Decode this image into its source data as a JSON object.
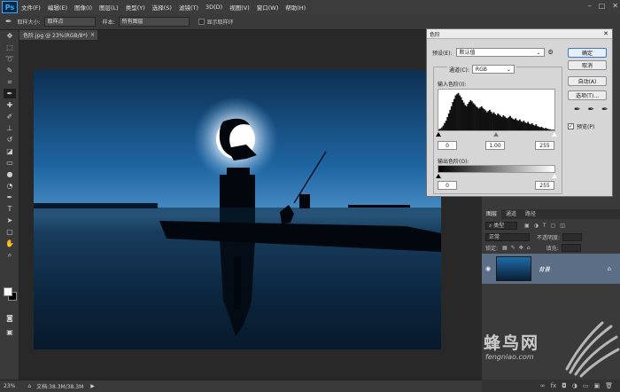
{
  "app": {
    "logo": "Ps"
  },
  "menubar": {
    "items": [
      "文件(F)",
      "编辑(E)",
      "图像(I)",
      "图层(L)",
      "类型(Y)",
      "选择(S)",
      "滤镜(T)",
      "3D(D)",
      "视图(V)",
      "窗口(W)",
      "帮助(H)"
    ],
    "window_controls": [
      "–",
      "□",
      "✕"
    ]
  },
  "optionsbar": {
    "sample_size_label": "取样大小:",
    "sample_size_value": "取样点",
    "sample_label": "样本:",
    "sample_value": "所有图层",
    "show_ring_label": "显示取样环"
  },
  "document": {
    "tab_title": "色阶.jpg @ 23%(RGB/8*)",
    "close": "×"
  },
  "statusbar": {
    "zoom": "23%",
    "doc_info": "文档:38.3M/38.3M"
  },
  "levels": {
    "title": "色阶",
    "close": "✕",
    "preset_label": "预设(E):",
    "preset_value": "默认值",
    "channel_label": "通道(C):",
    "channel_value": "RGB",
    "input_label": "输入色阶(I):",
    "input_black": "0",
    "input_gamma": "1.00",
    "input_white": "255",
    "output_label": "输出色阶(O):",
    "output_black": "0",
    "output_white": "255",
    "buttons": {
      "ok": "确定",
      "cancel": "取消",
      "auto": "自动(A)",
      "options": "选项(T)..."
    },
    "preview_label": "预览(P)",
    "preview_checked": true,
    "histogram": [
      2,
      3,
      5,
      8,
      12,
      16,
      22,
      28,
      34,
      40,
      47,
      52,
      58,
      60,
      62,
      58,
      55,
      50,
      46,
      42,
      40,
      44,
      47,
      50,
      48,
      45,
      43,
      40,
      38,
      36,
      38,
      40,
      37,
      35,
      33,
      30,
      32,
      34,
      31,
      28,
      30,
      27,
      25,
      28,
      26,
      24,
      22,
      25,
      23,
      21,
      20,
      22,
      24,
      21,
      19,
      18,
      20,
      17,
      16,
      18,
      15,
      14,
      16,
      13,
      12,
      14,
      11,
      10,
      12,
      9,
      8,
      10,
      7,
      6,
      5,
      6,
      4,
      3,
      4,
      3,
      2,
      2,
      1,
      1,
      1
    ]
  },
  "layers": {
    "tabs": [
      "图层",
      "通道",
      "路径"
    ],
    "kind_label": "类型",
    "blend_mode": "正常",
    "opacity_label": "不透明度:",
    "lock_label": "锁定:",
    "fill_label": "填充:",
    "layer_name": "背景"
  },
  "watermark": {
    "text": "蜂鸟网",
    "sub": "fengniao.com"
  }
}
